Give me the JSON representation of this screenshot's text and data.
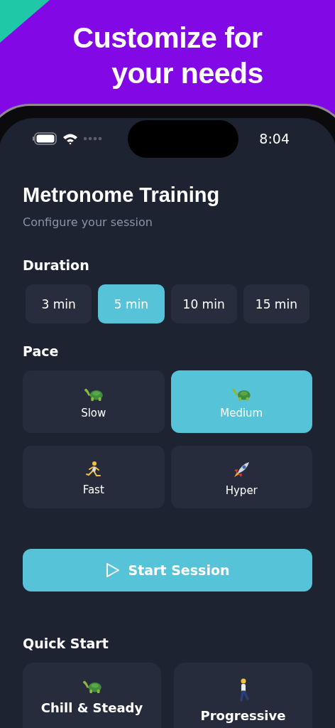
{
  "banner": {
    "title_lines": [
      "Customize for",
      "your needs"
    ]
  },
  "status_bar": {
    "time": "8:04"
  },
  "header": {
    "title": "Metronome Training",
    "subtitle": "Configure your session"
  },
  "duration": {
    "label": "Duration",
    "options": [
      {
        "label": "3 min",
        "selected": false
      },
      {
        "label": "5 min",
        "selected": true
      },
      {
        "label": "10 min",
        "selected": false
      },
      {
        "label": "15 min",
        "selected": false
      }
    ]
  },
  "pace": {
    "label": "Pace",
    "options": [
      {
        "label": "Slow",
        "kind": "turtle",
        "selected": false
      },
      {
        "label": "Medium",
        "kind": "turtle",
        "selected": true
      },
      {
        "label": "Fast",
        "kind": "runner",
        "selected": false
      },
      {
        "label": "Hyper",
        "kind": "rocket",
        "selected": false
      }
    ]
  },
  "start_button": {
    "label": "Start Session"
  },
  "quick_start": {
    "label": "Quick Start",
    "presets": [
      {
        "label": "Chill & Steady",
        "kind": "turtle"
      },
      {
        "label": "Progressive",
        "kind": "walker"
      }
    ]
  }
}
